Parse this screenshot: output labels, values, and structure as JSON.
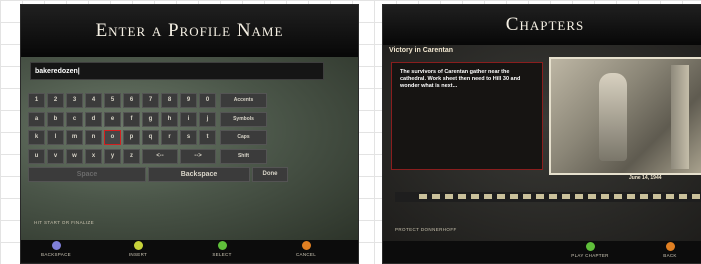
{
  "profile_screen": {
    "title": "Enter a Profile Name",
    "name_value": "bakeredozen|",
    "keys": [
      [
        "1",
        "2",
        "3",
        "4",
        "5",
        "6",
        "7",
        "8",
        "9",
        "0"
      ],
      [
        "a",
        "b",
        "c",
        "d",
        "e",
        "f",
        "g",
        "h",
        "i",
        "j"
      ],
      [
        "k",
        "l",
        "m",
        "n",
        "o",
        "p",
        "q",
        "r",
        "s",
        "t"
      ],
      [
        "u",
        "v",
        "w",
        "x",
        "y",
        "z"
      ]
    ],
    "side_keys": [
      "Accents",
      "Symbols",
      "Caps",
      "Shift"
    ],
    "row4_extra": [
      "<--",
      "-->"
    ],
    "bottom_keys": [
      "Space",
      "Backspace",
      "Done"
    ],
    "hint": "HIT START OR FINALIZE",
    "footer": [
      {
        "label": "BACKSPACE",
        "color": "#7f7fd8"
      },
      {
        "label": "INSERT",
        "color": "#c7d23a"
      },
      {
        "label": "SELECT",
        "color": "#5fbf3a"
      },
      {
        "label": "CANCEL",
        "color": "#e07f22"
      }
    ]
  },
  "chapters_screen": {
    "title": "Chapters",
    "chapter_title": "Victory in Carentan",
    "description": "The survivors of Carentan gather near the cathedral. Work sheet then need to Hill 30 and wonder what is next...",
    "date": "June 14, 1944",
    "hint": "PROTECT DONNERHOFF",
    "footer": [
      {
        "label": "PLAY CHAPTER",
        "color": "#5fbf3a"
      },
      {
        "label": "BACK",
        "color": "#e07f22"
      }
    ]
  }
}
